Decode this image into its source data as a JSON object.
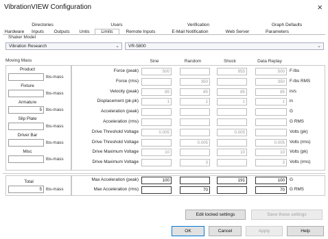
{
  "window": {
    "title": "VibrationVIEW Configuration",
    "close_glyph": "×"
  },
  "tabs_row1": [
    "Directories",
    "Users",
    "Verification",
    "Graph Defaults"
  ],
  "tabs_row2": [
    "Hardware",
    "Inputs",
    "Outputs",
    "Units",
    "Limits",
    "Remote Inputs",
    "E-Mail Notification",
    "Web Server",
    "Parameters"
  ],
  "active_tab": "Limits",
  "shaker_model": {
    "label": "Shaker Model",
    "manufacturer": "Vibration Research",
    "model": "VR-5800"
  },
  "moving_mass": {
    "label": "Moving Mass",
    "unit": "lbs-mass",
    "items": [
      {
        "label": "Product",
        "value": ""
      },
      {
        "label": "Fixture",
        "value": ""
      },
      {
        "label": "Armature",
        "value": "5"
      },
      {
        "label": "Slip Plate",
        "value": ""
      },
      {
        "label": "Driver Bar",
        "value": ""
      },
      {
        "label": "Misc",
        "value": ""
      }
    ],
    "total": {
      "label": "Total",
      "value": "5"
    }
  },
  "limits": {
    "columns": [
      "Sine",
      "Random",
      "Shock",
      "Data Replay"
    ],
    "rows": [
      {
        "label": "Force (peak)",
        "values": [
          "500",
          "",
          "955",
          "500"
        ],
        "unit": "F-lbs"
      },
      {
        "label": "Force (rms)",
        "values": [
          "",
          "350",
          "",
          "350"
        ],
        "unit": "F-lbs RMS"
      },
      {
        "label": "Velocity (peak)",
        "values": [
          "85",
          "85",
          "85",
          "85"
        ],
        "unit": "in/s"
      },
      {
        "label": "Displacement (pk-pk)",
        "values": [
          "1",
          "1",
          "1",
          "1"
        ],
        "unit": "in"
      },
      {
        "label": "Acceleration (peak)",
        "values": [
          "",
          "",
          "",
          ""
        ],
        "unit": "G"
      },
      {
        "label": "Acceleration (rms)",
        "values": [
          "",
          "",
          "",
          ""
        ],
        "unit": "G RMS"
      },
      {
        "label": "Drive Threshold Voltage",
        "values": [
          "0.005",
          "",
          "0.005",
          ""
        ],
        "unit": "Volts (pk)"
      },
      {
        "label": "Drive Threshold Voltage",
        "values": [
          "",
          "0.005",
          "",
          "0.005"
        ],
        "unit": "Volts (rms)"
      },
      {
        "label": "Drive Maximum Voltage",
        "values": [
          "10",
          "",
          "10",
          "10"
        ],
        "unit": "Volts (pk)"
      },
      {
        "label": "Drive Maximum Voltage",
        "values": [
          "",
          "3",
          "",
          "3"
        ],
        "unit": "Volts (rms)"
      }
    ],
    "max_rows": [
      {
        "label": "Max Acceleration (peak)",
        "values": [
          "100",
          "",
          "191",
          "100"
        ],
        "unit": "G"
      },
      {
        "label": "Max Acceleration (rms)",
        "values": [
          "",
          "70",
          "",
          "70"
        ],
        "unit": "G RMS"
      }
    ]
  },
  "buttons": {
    "edit_locked": "Edit locked settings",
    "save_these": "Save these settings",
    "ok": "OK",
    "cancel": "Cancel",
    "apply": "Apply",
    "help": "Help"
  }
}
